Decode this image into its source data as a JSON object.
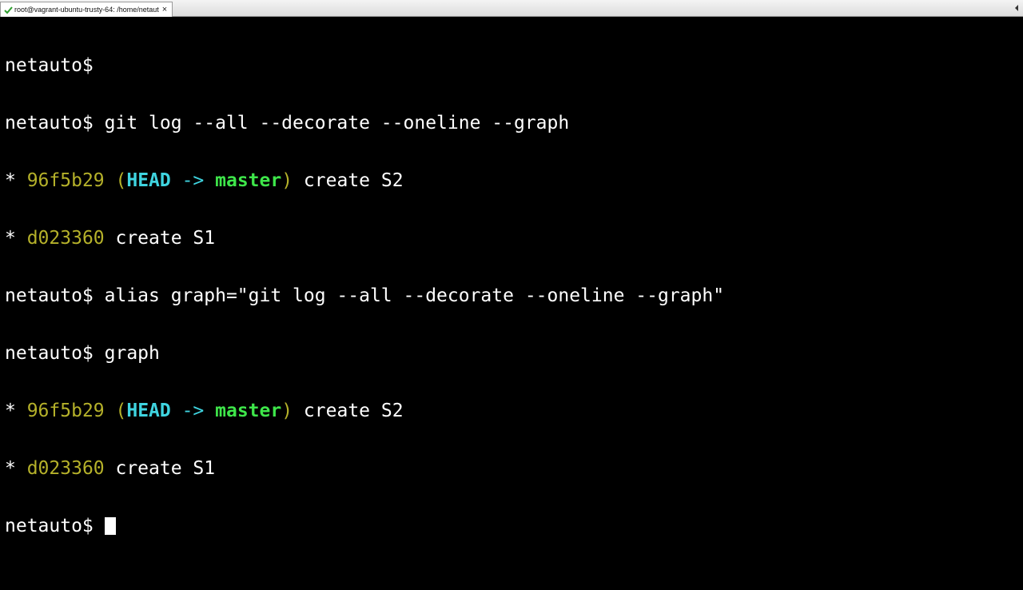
{
  "window": {
    "tab_title": "root@vagrant-ubuntu-trusty-64: /home/netauto",
    "tab_close": "×"
  },
  "terminal": {
    "lines": [
      {
        "prompt": "netauto$",
        "command": ""
      },
      {
        "prompt": "netauto$",
        "command": " git log --all --decorate --oneline --graph"
      },
      {
        "star": "* ",
        "hash": "96f5b29",
        "open": " (",
        "head": "HEAD",
        "arrow": " -> ",
        "branch": "master",
        "close": ")",
        "msg": " create S2"
      },
      {
        "star": "* ",
        "hash": "d023360",
        "msg": " create S1"
      },
      {
        "prompt": "netauto$",
        "command": " alias graph=\"git log --all --decorate --oneline --graph\""
      },
      {
        "prompt": "netauto$",
        "command": " graph"
      },
      {
        "star": "* ",
        "hash": "96f5b29",
        "open": " (",
        "head": "HEAD",
        "arrow": " -> ",
        "branch": "master",
        "close": ")",
        "msg": " create S2"
      },
      {
        "star": "* ",
        "hash": "d023360",
        "msg": " create S1"
      },
      {
        "prompt": "netauto$",
        "command": " "
      }
    ]
  },
  "colors": {
    "background": "#000000",
    "text": "#ffffff",
    "hash": "#b5b12a",
    "head": "#3fd4e0",
    "branch": "#3ee64a"
  }
}
